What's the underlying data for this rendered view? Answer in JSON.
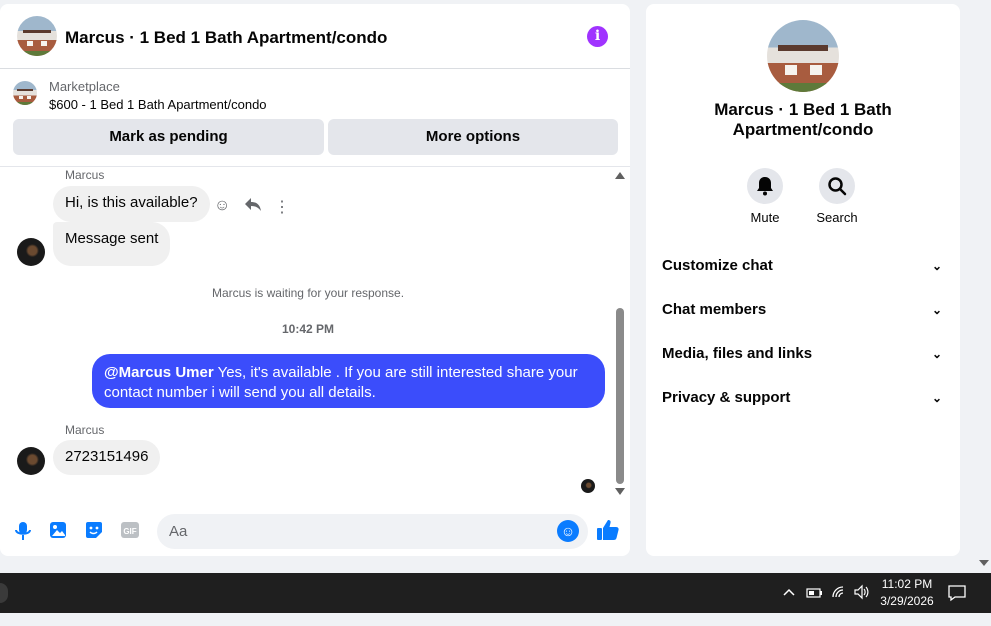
{
  "chat": {
    "title": "Marcus · 1 Bed 1 Bath Apartment/condo",
    "marketplace_label": "Marketplace",
    "listing": "$600 - 1 Bed 1 Bath Apartment/condo",
    "mark_pending": "Mark as pending",
    "more_options": "More options",
    "messages": [
      {
        "sender": "Marcus",
        "text": "Hi, is this available?"
      },
      {
        "text": "Message sent"
      },
      {
        "system": "Marcus is waiting for your response."
      },
      {
        "time": "10:42 PM"
      },
      {
        "mention": "@Marcus Umer",
        "text": " Yes, it's available . If you are still interested share your contact number i will send you all details."
      },
      {
        "sender": "Marcus",
        "text": "2723151496"
      }
    ],
    "composer_placeholder": "Aa"
  },
  "info": {
    "title": "Marcus · 1 Bed 1 Bath Apartment/condo",
    "actions": [
      {
        "label": "Mute",
        "icon": "bell-icon"
      },
      {
        "label": "Search",
        "icon": "search-icon"
      }
    ],
    "sections": [
      {
        "label": "Customize chat"
      },
      {
        "label": "Chat members"
      },
      {
        "label": "Media, files and links"
      },
      {
        "label": "Privacy & support"
      }
    ]
  },
  "taskbar": {
    "time": "11:02 PM",
    "date": "3/29/2026"
  },
  "colors": {
    "accent": "#0a7cff",
    "outgoing_bubble": "#3b4dfb",
    "info_icon": "#a033ff"
  }
}
